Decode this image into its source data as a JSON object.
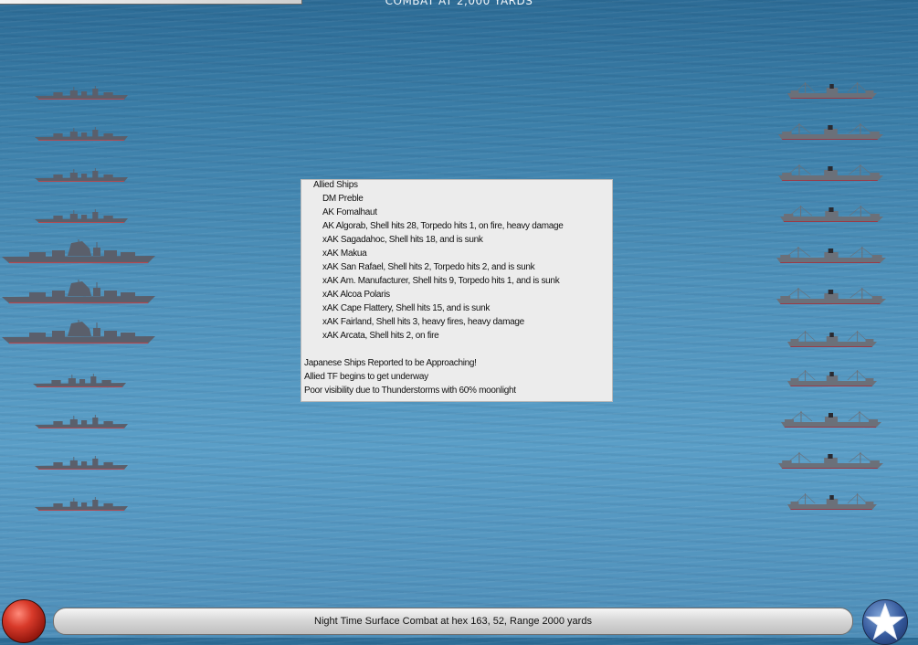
{
  "combat_title": "COMBAT AT 2,000 YARDS",
  "report": {
    "header": "Allied Ships",
    "ships": [
      "DM Preble",
      "AK Fomalhaut",
      "AK Algorab, Shell hits 28, Torpedo hits 1,  on fire,  heavy damage",
      "xAK Sagadahoc, Shell hits 18, and is sunk",
      "xAK Makua",
      "xAK San Rafael, Shell hits 2, Torpedo hits 2, and is sunk",
      "xAK Am. Manufacturer, Shell hits 9, Torpedo hits 1, and is sunk",
      "xAK Alcoa Polaris",
      "xAK Cape Flattery, Shell hits 15, and is sunk",
      "xAK Fairland, Shell hits 3,  heavy fires,  heavy damage",
      "xAK Arcata, Shell hits 2,  on fire"
    ],
    "events": [
      "Japanese Ships Reported to be Approaching!",
      "Allied TF begins to get underway",
      "Poor visibility due to Thunderstorms with 60% moonlight"
    ]
  },
  "status_bar": {
    "text": "Night Time Surface Combat at hex 163, 52, Range 2000 yards"
  },
  "colors": {
    "ocean": "#4a8cb8",
    "report_bg": "#ececec",
    "ship_hull_japanese": "#5a5f6b",
    "ship_hull_allied": "#6b7079",
    "stop_button": "#c0281a",
    "star_button": "#33579a"
  },
  "icons": {
    "stop": "red-stop-button-icon",
    "star": "allied-star-icon"
  }
}
